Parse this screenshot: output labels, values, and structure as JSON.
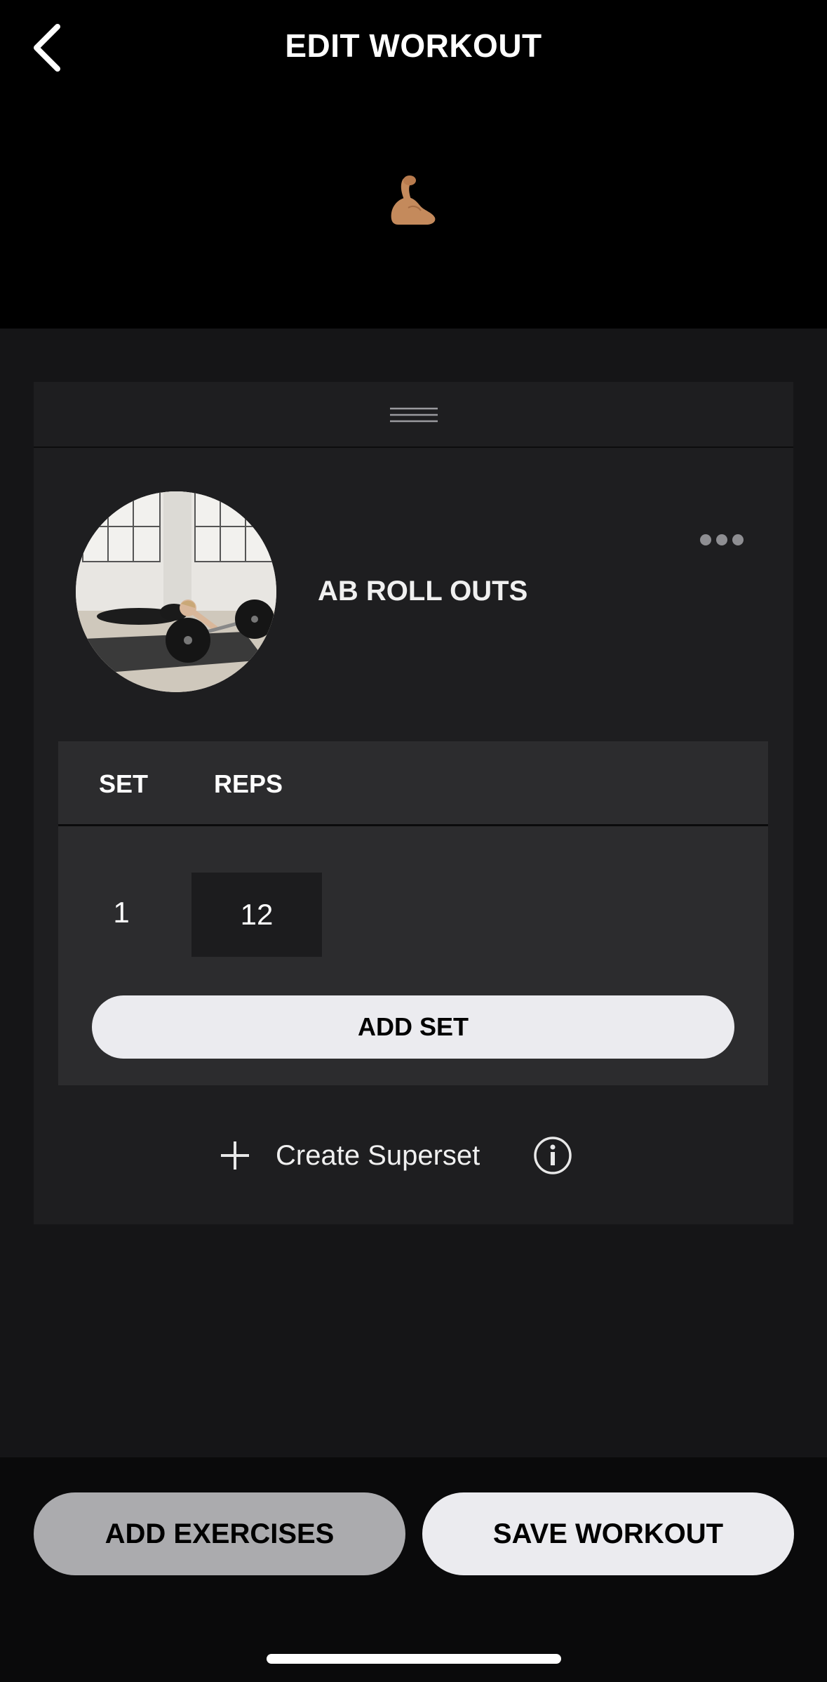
{
  "header": {
    "title": "EDIT WORKOUT",
    "back_icon": "chevron-left-icon",
    "emoji": "💪"
  },
  "exercise": {
    "name": "AB ROLL OUTS",
    "thumbnail_icon": "exercise-photo",
    "more_icon": "more-horizontal-icon",
    "table": {
      "columns": [
        "SET",
        "REPS"
      ],
      "rows": [
        {
          "set": "1",
          "reps": "12"
        }
      ]
    },
    "add_set_label": "ADD SET",
    "superset_label": "Create Superset",
    "superset_icon": "plus-icon",
    "info_icon": "info-icon"
  },
  "footer": {
    "add_exercises_label": "ADD EXERCISES",
    "save_workout_label": "SAVE WORKOUT"
  },
  "colors": {
    "background": "#000000",
    "content_bg": "#151517",
    "card_bg": "#1e1e20",
    "table_bg": "#2c2c2e",
    "primary_button": "#ebebef",
    "secondary_button": "#ababae"
  }
}
